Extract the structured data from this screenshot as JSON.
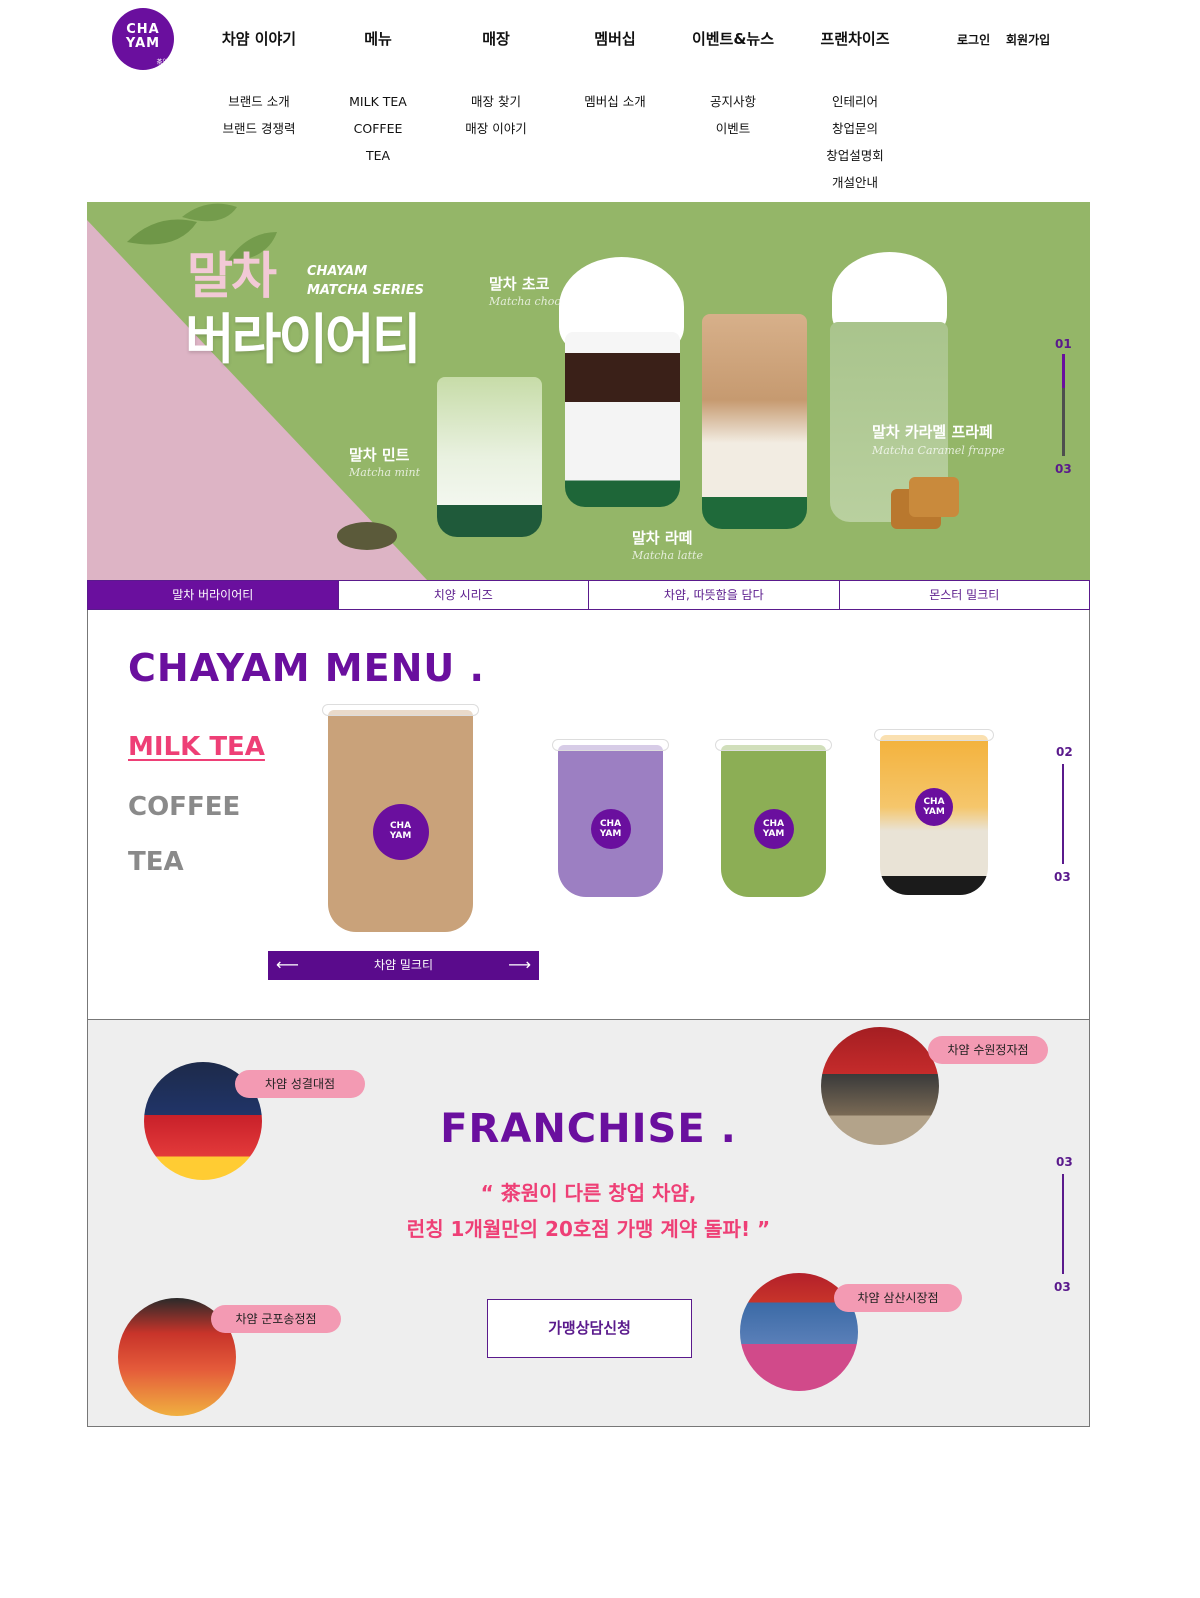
{
  "brand": {
    "logo_line1": "CHA",
    "logo_line2": "YAM",
    "logo_small": "茶양"
  },
  "nav": {
    "main": [
      "차얌 이야기",
      "메뉴",
      "매장",
      "멤버십",
      "이벤트&뉴스",
      "프랜차이즈"
    ],
    "util": [
      "로그인",
      "회원가입"
    ],
    "sub": [
      [
        "브랜드 소개",
        "브랜드 경쟁력"
      ],
      [
        "MILK TEA",
        "COFFEE",
        "TEA"
      ],
      [
        "매장 찾기",
        "매장 이야기"
      ],
      [
        "멤버십 소개"
      ],
      [
        "공지사항",
        "이벤트"
      ],
      [
        "인테리어",
        "창업문의",
        "창업설명회",
        "개설안내"
      ]
    ]
  },
  "hero": {
    "title_line1": "말차",
    "title_line2": "버라이어티",
    "sub_line1": "CHAYAM",
    "sub_line2": "MATCHA SERIES",
    "drinks": [
      {
        "name": "말차 민트",
        "script": "Matcha mint"
      },
      {
        "name": "말차 초코",
        "script": "Matcha choco"
      },
      {
        "name": "말차 라떼",
        "script": "Matcha latte"
      },
      {
        "name": "말차 카라멜 프라페",
        "script": "Matcha Caramel frappe"
      }
    ],
    "indicator_top": "01",
    "indicator_bottom": "03",
    "slide_current": 1,
    "slide_total": 3,
    "colors": {
      "green": "#94b668",
      "pink": "#ddb4c5"
    }
  },
  "tabs": [
    "말차 버라이어티",
    "치양 시리즈",
    "차얌, 따뜻함을 담다",
    "몬스터 밀크티"
  ],
  "menu": {
    "title": "CHAYAM MENU .",
    "categories": [
      "MILK TEA",
      "COFFEE",
      "TEA"
    ],
    "nav_label": "차얌 밀크티",
    "nav_prev": "⟵",
    "nav_next": "⟶",
    "indicator_top": "02",
    "indicator_bottom": "03",
    "cups": [
      {
        "badge1": "CHA",
        "badge2": "YAM",
        "color": "#c9a27a"
      },
      {
        "badge1": "CHA",
        "badge2": "YAM",
        "color": "#9c7fc2"
      },
      {
        "badge1": "CHA",
        "badge2": "YAM",
        "color": "#8cae55"
      },
      {
        "badge1": "CHA",
        "badge2": "YAM",
        "color": "#f3b13a"
      }
    ]
  },
  "franchise": {
    "title": "FRANCHISE .",
    "quote_line1": "“ 茶원이 다른 창업 차얌,",
    "quote_line2": "런칭 1개월만의 20호점 가맹 계약 돌파! ”",
    "button": "가맹상담신청",
    "indicator_top": "03",
    "indicator_bottom": "03",
    "stores": [
      "차얌 성결대점",
      "차얌 수원정자점",
      "차얌 군포송정점",
      "차얌 삼산시장점"
    ]
  },
  "colors": {
    "purple": "#6a0f9e",
    "pink_accent": "#ee3f76",
    "label_pink": "#f39ab3"
  }
}
